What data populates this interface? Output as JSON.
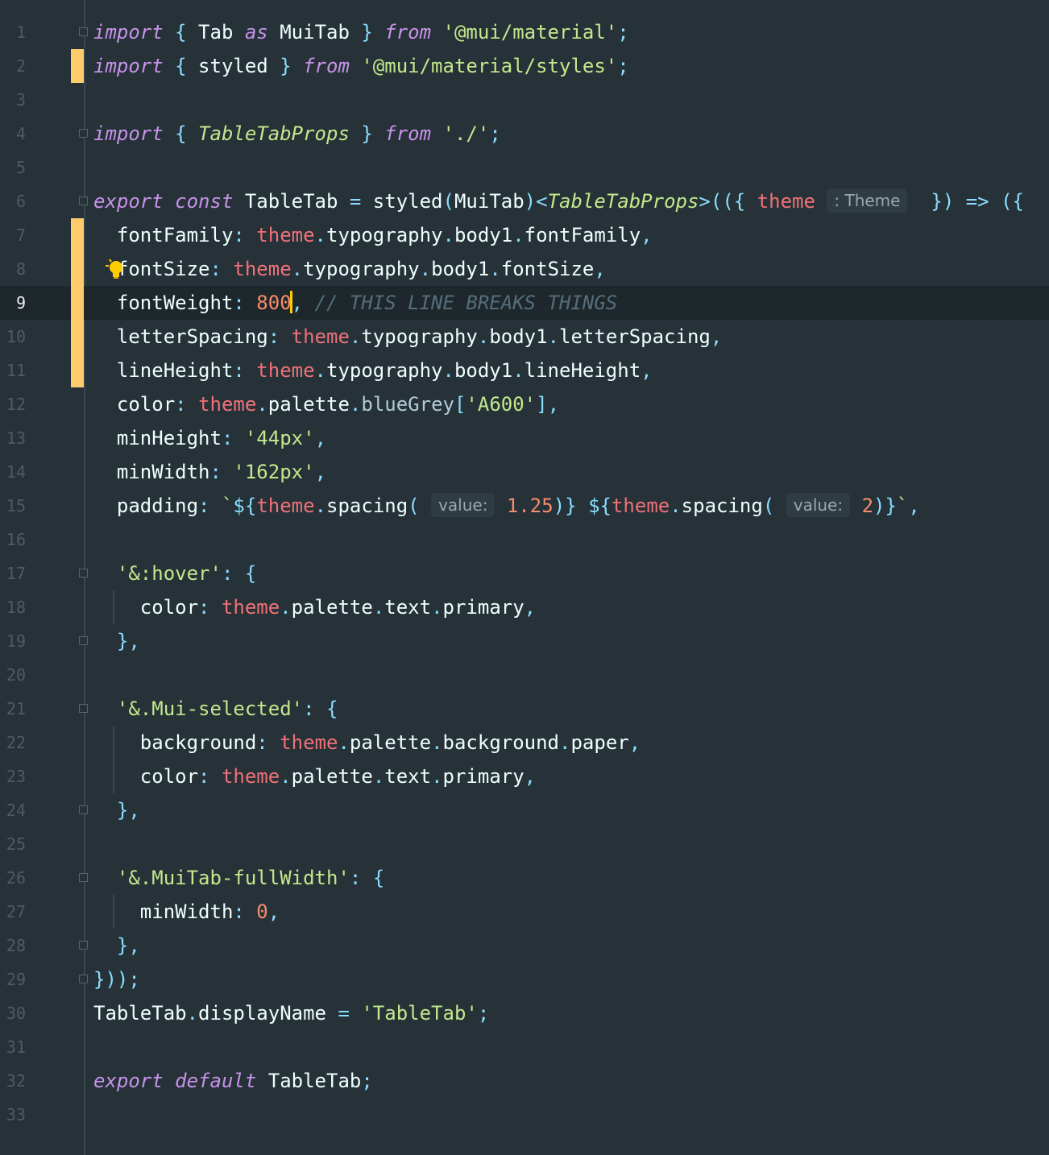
{
  "editor": {
    "line_numbers": [
      "1",
      "2",
      "3",
      "4",
      "5",
      "6",
      "7",
      "8",
      "9",
      "10",
      "11",
      "12",
      "13",
      "14",
      "15",
      "16",
      "17",
      "18",
      "19",
      "20",
      "21",
      "22",
      "23",
      "24",
      "25",
      "26",
      "27",
      "28",
      "29",
      "30",
      "31",
      "32",
      "33"
    ],
    "lines": [
      [
        {
          "t": "import",
          "k": "kw"
        },
        {
          "t": " "
        },
        {
          "t": "{",
          "k": "p"
        },
        {
          "t": " Tab ",
          "k": "pl"
        },
        {
          "t": "as",
          "k": "kw"
        },
        {
          "t": " MuiTab ",
          "k": "pl"
        },
        {
          "t": "}",
          "k": "p"
        },
        {
          "t": " "
        },
        {
          "t": "from",
          "k": "kw"
        },
        {
          "t": " "
        },
        {
          "t": "'@mui/material'",
          "k": "str"
        },
        {
          "t": ";",
          "k": "p"
        }
      ],
      [
        {
          "t": "import",
          "k": "kw"
        },
        {
          "t": " "
        },
        {
          "t": "{",
          "k": "p"
        },
        {
          "t": " styled ",
          "k": "pl"
        },
        {
          "t": "}",
          "k": "p"
        },
        {
          "t": " "
        },
        {
          "t": "from",
          "k": "kw"
        },
        {
          "t": " "
        },
        {
          "t": "'@mui/material/styles'",
          "k": "str"
        },
        {
          "t": ";",
          "k": "p"
        }
      ],
      [],
      [
        {
          "t": "import",
          "k": "kw"
        },
        {
          "t": " "
        },
        {
          "t": "{",
          "k": "p"
        },
        {
          "t": " "
        },
        {
          "t": "TableTabProps",
          "k": "ty"
        },
        {
          "t": " "
        },
        {
          "t": "}",
          "k": "p"
        },
        {
          "t": " "
        },
        {
          "t": "from",
          "k": "kw"
        },
        {
          "t": " "
        },
        {
          "t": "'./'",
          "k": "str"
        },
        {
          "t": ";",
          "k": "p"
        }
      ],
      [],
      [
        {
          "t": "export",
          "k": "kw"
        },
        {
          "t": " "
        },
        {
          "t": "const",
          "k": "kw"
        },
        {
          "t": " TableTab ",
          "k": "pl"
        },
        {
          "t": "=",
          "k": "p"
        },
        {
          "t": " styled",
          "k": "pl"
        },
        {
          "t": "(",
          "k": "p"
        },
        {
          "t": "MuiTab",
          "k": "pl"
        },
        {
          "t": ")<",
          "k": "p"
        },
        {
          "t": "TableTabProps",
          "k": "ty"
        },
        {
          "t": ">(({",
          "k": "p"
        },
        {
          "t": " "
        },
        {
          "t": "theme",
          "k": "th"
        },
        {
          "t": " "
        },
        {
          "h": "hint-theme"
        },
        {
          "t": "  "
        },
        {
          "t": "}) => ({",
          "k": "p"
        }
      ],
      [
        {
          "t": "  fontFamily",
          "k": "prop"
        },
        {
          "t": ":",
          "k": "p"
        },
        {
          "t": " "
        },
        {
          "t": "theme",
          "k": "th"
        },
        {
          "t": ".",
          "k": "p"
        },
        {
          "t": "typography",
          "k": "pl"
        },
        {
          "t": ".",
          "k": "p"
        },
        {
          "t": "body1",
          "k": "pl"
        },
        {
          "t": ".",
          "k": "p"
        },
        {
          "t": "fontFamily",
          "k": "pl"
        },
        {
          "t": ",",
          "k": "p"
        }
      ],
      [
        {
          "t": "  fontSize",
          "k": "prop"
        },
        {
          "t": ":",
          "k": "p"
        },
        {
          "t": " "
        },
        {
          "t": "theme",
          "k": "th"
        },
        {
          "t": ".",
          "k": "p"
        },
        {
          "t": "typography",
          "k": "pl"
        },
        {
          "t": ".",
          "k": "p"
        },
        {
          "t": "body1",
          "k": "pl"
        },
        {
          "t": ".",
          "k": "p"
        },
        {
          "t": "fontSize",
          "k": "pl"
        },
        {
          "t": ",",
          "k": "p"
        }
      ],
      [
        {
          "t": "  fontWeight",
          "k": "prop"
        },
        {
          "t": ":",
          "k": "p"
        },
        {
          "t": " "
        },
        {
          "t": "800",
          "k": "num"
        },
        {
          "caret": true
        },
        {
          "t": ",",
          "k": "p"
        },
        {
          "t": " "
        },
        {
          "t": "// THIS LINE BREAKS THINGS",
          "k": "cm"
        }
      ],
      [
        {
          "t": "  letterSpacing",
          "k": "prop"
        },
        {
          "t": ":",
          "k": "p"
        },
        {
          "t": " "
        },
        {
          "t": "theme",
          "k": "th"
        },
        {
          "t": ".",
          "k": "p"
        },
        {
          "t": "typography",
          "k": "pl"
        },
        {
          "t": ".",
          "k": "p"
        },
        {
          "t": "body1",
          "k": "pl"
        },
        {
          "t": ".",
          "k": "p"
        },
        {
          "t": "letterSpacing",
          "k": "pl"
        },
        {
          "t": ",",
          "k": "p"
        }
      ],
      [
        {
          "t": "  lineHeight",
          "k": "prop"
        },
        {
          "t": ":",
          "k": "p"
        },
        {
          "t": " "
        },
        {
          "t": "theme",
          "k": "th"
        },
        {
          "t": ".",
          "k": "p"
        },
        {
          "t": "typography",
          "k": "pl"
        },
        {
          "t": ".",
          "k": "p"
        },
        {
          "t": "body1",
          "k": "pl"
        },
        {
          "t": ".",
          "k": "p"
        },
        {
          "t": "lineHeight",
          "k": "pl"
        },
        {
          "t": ",",
          "k": "p"
        }
      ],
      [
        {
          "t": "  color",
          "k": "prop"
        },
        {
          "t": ":",
          "k": "p"
        },
        {
          "t": " "
        },
        {
          "t": "theme",
          "k": "th"
        },
        {
          "t": ".",
          "k": "p"
        },
        {
          "t": "palette",
          "k": "pl"
        },
        {
          "t": ".",
          "k": "p"
        },
        {
          "t": "blueGrey",
          "k": "mem"
        },
        {
          "t": "[",
          "k": "p"
        },
        {
          "t": "'A600'",
          "k": "str"
        },
        {
          "t": "],",
          "k": "p"
        }
      ],
      [
        {
          "t": "  minHeight",
          "k": "prop"
        },
        {
          "t": ":",
          "k": "p"
        },
        {
          "t": " "
        },
        {
          "t": "'44px'",
          "k": "str"
        },
        {
          "t": ",",
          "k": "p"
        }
      ],
      [
        {
          "t": "  minWidth",
          "k": "prop"
        },
        {
          "t": ":",
          "k": "p"
        },
        {
          "t": " "
        },
        {
          "t": "'162px'",
          "k": "str"
        },
        {
          "t": ",",
          "k": "p"
        }
      ],
      [
        {
          "t": "  padding",
          "k": "prop"
        },
        {
          "t": ":",
          "k": "p"
        },
        {
          "t": " "
        },
        {
          "t": "`",
          "k": "str"
        },
        {
          "t": "${",
          "k": "p"
        },
        {
          "t": "theme",
          "k": "th"
        },
        {
          "t": ".",
          "k": "p"
        },
        {
          "t": "spacing",
          "k": "pl"
        },
        {
          "t": "(",
          "k": "p"
        },
        {
          "t": " "
        },
        {
          "h": "hint-value-1"
        },
        {
          "t": " "
        },
        {
          "t": "1.25",
          "k": "num"
        },
        {
          "t": ")}",
          "k": "p"
        },
        {
          "t": " "
        },
        {
          "t": "${",
          "k": "p"
        },
        {
          "t": "theme",
          "k": "th"
        },
        {
          "t": ".",
          "k": "p"
        },
        {
          "t": "spacing",
          "k": "pl"
        },
        {
          "t": "(",
          "k": "p"
        },
        {
          "t": " "
        },
        {
          "h": "hint-value-2"
        },
        {
          "t": " "
        },
        {
          "t": "2",
          "k": "num"
        },
        {
          "t": ")}",
          "k": "p"
        },
        {
          "t": "`",
          "k": "str"
        },
        {
          "t": ",",
          "k": "p"
        }
      ],
      [],
      [
        {
          "t": "  "
        },
        {
          "t": "'&:hover'",
          "k": "str"
        },
        {
          "t": ":",
          "k": "p"
        },
        {
          "t": " "
        },
        {
          "t": "{",
          "k": "p"
        }
      ],
      [
        {
          "t": "    color",
          "k": "prop"
        },
        {
          "t": ":",
          "k": "p"
        },
        {
          "t": " "
        },
        {
          "t": "theme",
          "k": "th"
        },
        {
          "t": ".",
          "k": "p"
        },
        {
          "t": "palette",
          "k": "pl"
        },
        {
          "t": ".",
          "k": "p"
        },
        {
          "t": "text",
          "k": "pl"
        },
        {
          "t": ".",
          "k": "p"
        },
        {
          "t": "primary",
          "k": "pl"
        },
        {
          "t": ",",
          "k": "p"
        }
      ],
      [
        {
          "t": "  "
        },
        {
          "t": "},",
          "k": "p"
        }
      ],
      [],
      [
        {
          "t": "  "
        },
        {
          "t": "'&.Mui-selected'",
          "k": "str"
        },
        {
          "t": ":",
          "k": "p"
        },
        {
          "t": " "
        },
        {
          "t": "{",
          "k": "p"
        }
      ],
      [
        {
          "t": "    background",
          "k": "prop"
        },
        {
          "t": ":",
          "k": "p"
        },
        {
          "t": " "
        },
        {
          "t": "theme",
          "k": "th"
        },
        {
          "t": ".",
          "k": "p"
        },
        {
          "t": "palette",
          "k": "pl"
        },
        {
          "t": ".",
          "k": "p"
        },
        {
          "t": "background",
          "k": "pl"
        },
        {
          "t": ".",
          "k": "p"
        },
        {
          "t": "paper",
          "k": "pl"
        },
        {
          "t": ",",
          "k": "p"
        }
      ],
      [
        {
          "t": "    color",
          "k": "prop"
        },
        {
          "t": ":",
          "k": "p"
        },
        {
          "t": " "
        },
        {
          "t": "theme",
          "k": "th"
        },
        {
          "t": ".",
          "k": "p"
        },
        {
          "t": "palette",
          "k": "pl"
        },
        {
          "t": ".",
          "k": "p"
        },
        {
          "t": "text",
          "k": "pl"
        },
        {
          "t": ".",
          "k": "p"
        },
        {
          "t": "primary",
          "k": "pl"
        },
        {
          "t": ",",
          "k": "p"
        }
      ],
      [
        {
          "t": "  "
        },
        {
          "t": "},",
          "k": "p"
        }
      ],
      [],
      [
        {
          "t": "  "
        },
        {
          "t": "'&.MuiTab-fullWidth'",
          "k": "str"
        },
        {
          "t": ":",
          "k": "p"
        },
        {
          "t": " "
        },
        {
          "t": "{",
          "k": "p"
        }
      ],
      [
        {
          "t": "    minWidth",
          "k": "prop"
        },
        {
          "t": ":",
          "k": "p"
        },
        {
          "t": " "
        },
        {
          "t": "0",
          "k": "num"
        },
        {
          "t": ",",
          "k": "p"
        }
      ],
      [
        {
          "t": "  "
        },
        {
          "t": "},",
          "k": "p"
        }
      ],
      [
        {
          "t": "}));",
          "k": "p"
        }
      ],
      [
        {
          "t": "TableTab",
          "k": "pl"
        },
        {
          "t": ".",
          "k": "p"
        },
        {
          "t": "displayName ",
          "k": "pl"
        },
        {
          "t": "=",
          "k": "p"
        },
        {
          "t": " "
        },
        {
          "t": "'TableTab'",
          "k": "str"
        },
        {
          "t": ";",
          "k": "p"
        }
      ],
      [],
      [
        {
          "t": "export",
          "k": "kw"
        },
        {
          "t": " "
        },
        {
          "t": "default",
          "k": "kw"
        },
        {
          "t": " TableTab",
          "k": "pl"
        },
        {
          "t": ";",
          "k": "p"
        }
      ],
      []
    ],
    "hints": {
      "hint-theme": ": Theme",
      "hint-value-1": "value:",
      "hint-value-2": "value:"
    },
    "current_line": 9,
    "modified_lines": [
      2,
      7,
      8,
      9,
      10,
      11
    ],
    "fold_start_lines": [
      1,
      6,
      17,
      21,
      26
    ],
    "fold_end_lines": [
      4,
      19,
      24,
      28,
      29
    ],
    "intention_bulb_line": 8,
    "colors": {
      "background": "#263238",
      "current_line": "#1e272c",
      "keyword": "#c792ea",
      "string": "#c3e88d",
      "number": "#f78c6c",
      "punctuation": "#89ddff",
      "theme_param": "#f07178",
      "comment": "#546e7a",
      "vcs_modified": "#ffcb6b",
      "caret": "#ffcc00"
    }
  }
}
